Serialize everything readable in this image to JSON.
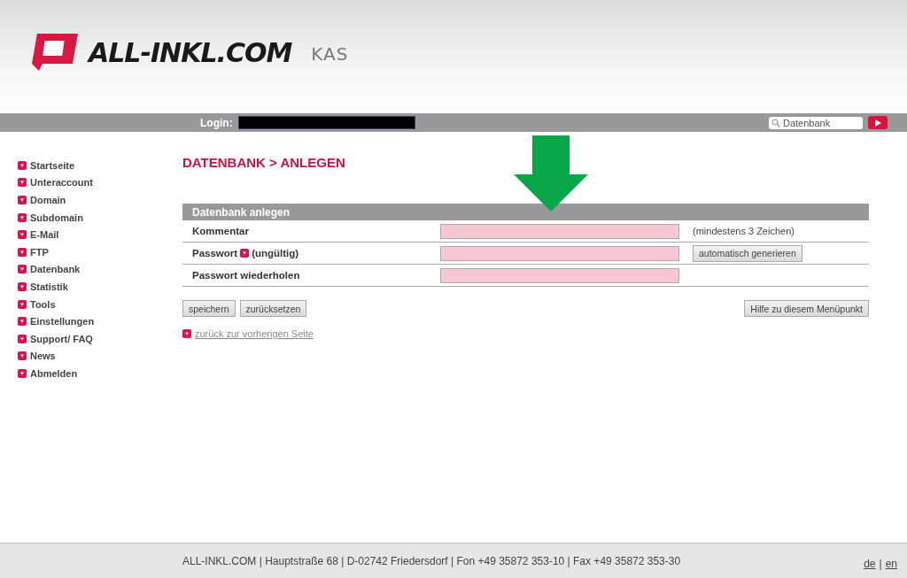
{
  "header": {
    "brand": "ALL-INKL.COM",
    "product": "KAS"
  },
  "topbar": {
    "login_label": "Login:",
    "search": {
      "value": "Datenbank"
    }
  },
  "sidebar": {
    "items": [
      {
        "label": "Startseite"
      },
      {
        "label": "Unteraccount"
      },
      {
        "label": "Domain"
      },
      {
        "label": "Subdomain"
      },
      {
        "label": "E-Mail"
      },
      {
        "label": "FTP"
      },
      {
        "label": "Datenbank"
      },
      {
        "label": "Statistik"
      },
      {
        "label": "Tools"
      },
      {
        "label": "Einstellungen"
      },
      {
        "label": "Support/ FAQ"
      },
      {
        "label": "News"
      },
      {
        "label": "Abmelden"
      }
    ]
  },
  "page_title": "DATENBANK > ANLEGEN",
  "form": {
    "title": "Datenbank anlegen",
    "rows": [
      {
        "label": "Kommentar",
        "invalid": true,
        "extra": {
          "kind": "note",
          "text": "(mindestens 3 Zeichen)"
        }
      },
      {
        "label": "Passwort",
        "status": "(ungültig)",
        "invalid": true,
        "extra": {
          "kind": "button",
          "text": "automatisch generieren"
        }
      },
      {
        "label": "Passwort wiederholen",
        "invalid": true
      }
    ],
    "buttons": [
      "speichern",
      "zurücksetzen"
    ],
    "help_button": "Hilfe zu diesem Menüpunkt",
    "back_link": "zurück zur vorherigen Seite"
  },
  "footer": {
    "address": "ALL-INKL.COM | Hauptstraße 68 | D-02742 Friedersdorf | Fon +49 35872 353-10 | Fax +49 35872 353-30",
    "languages": [
      "de",
      "en"
    ],
    "separator": "|"
  }
}
